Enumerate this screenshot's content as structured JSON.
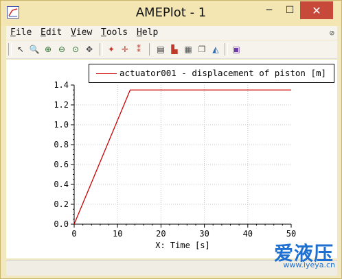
{
  "window": {
    "title": "AMEPlot - 1",
    "minimize_glyph": "─",
    "maximize_glyph": "☐",
    "close_glyph": "✕"
  },
  "menu": {
    "items": [
      {
        "key": "F",
        "rest": "ile"
      },
      {
        "key": "E",
        "rest": "dit"
      },
      {
        "key": "V",
        "rest": "iew"
      },
      {
        "key": "T",
        "rest": "ools"
      },
      {
        "key": "H",
        "rest": "elp"
      }
    ],
    "pin_glyph": "⊘"
  },
  "toolbar": {
    "buttons": [
      {
        "name": "select-arrow-icon",
        "glyph": "↖",
        "color": "#333333"
      },
      {
        "name": "zoom-icon",
        "glyph": "🔍",
        "color": "#444444"
      },
      {
        "name": "zoom-in-icon",
        "glyph": "⊕",
        "color": "#2a6e2a"
      },
      {
        "name": "zoom-out-icon",
        "glyph": "⊖",
        "color": "#2a6e2a"
      },
      {
        "name": "zoom-fit-icon",
        "glyph": "⊙",
        "color": "#2a6e2a"
      },
      {
        "name": "pan-icon",
        "glyph": "✥",
        "color": "#444444"
      },
      {
        "name": "marker-point-icon",
        "glyph": "✦",
        "color": "#c0392b"
      },
      {
        "name": "crosshair-icon",
        "glyph": "✛",
        "color": "#c0392b"
      },
      {
        "name": "dual-marker-icon",
        "glyph": "⁑",
        "color": "#c0392b"
      },
      {
        "name": "plot-frame-icon",
        "glyph": "▤",
        "color": "#333333"
      },
      {
        "name": "plot-curve-icon",
        "glyph": "▙",
        "color": "#c0392b"
      },
      {
        "name": "grid-icon",
        "glyph": "▦",
        "color": "#555555"
      },
      {
        "name": "copy-plot-icon",
        "glyph": "❐",
        "color": "#555555"
      },
      {
        "name": "colors-icon",
        "glyph": "◭",
        "color": "#2a6ebb"
      },
      {
        "name": "export-plot-icon",
        "glyph": "▣",
        "color": "#6a3aa8"
      }
    ]
  },
  "legend": {
    "entry": "actuator001 - displacement of piston [m]",
    "color": "#cc0000"
  },
  "chart_data": {
    "type": "line",
    "title": "",
    "xlabel": "X: Time [s]",
    "ylabel": "",
    "xlim": [
      0,
      50
    ],
    "ylim": [
      0,
      1.4
    ],
    "x_ticks": [
      "0",
      "10",
      "20",
      "30",
      "40",
      "50"
    ],
    "y_ticks": [
      "0.0",
      "0.2",
      "0.4",
      "0.6",
      "0.8",
      "1.0",
      "1.2",
      "1.4"
    ],
    "grid": true,
    "series": [
      {
        "name": "actuator001 - displacement of piston [m]",
        "color": "#cc0000",
        "x": [
          0,
          12.9,
          50
        ],
        "y": [
          0,
          1.35,
          1.35
        ]
      }
    ]
  },
  "watermark": {
    "text": "爱液压",
    "url": "www.iyeya.cn"
  }
}
